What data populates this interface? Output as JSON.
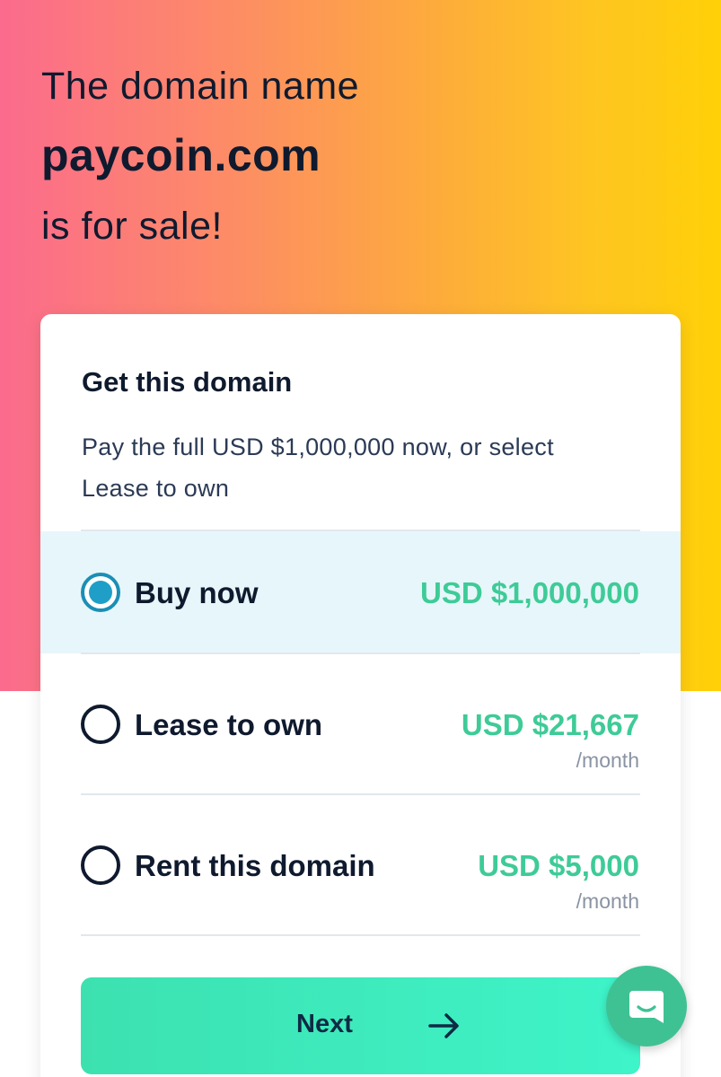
{
  "hero": {
    "line1": "The domain name",
    "domain": "paycoin.com",
    "line3": "is for sale!"
  },
  "card": {
    "title": "Get this domain",
    "description": "Pay the full USD $1,000,000 now, or select Lease to own"
  },
  "options": [
    {
      "label": "Buy now",
      "price": "USD $1,000,000",
      "period": "",
      "selected": true
    },
    {
      "label": "Lease to own",
      "price": "USD $21,667",
      "period": "/month",
      "selected": false
    },
    {
      "label": "Rent this domain",
      "price": "USD $5,000",
      "period": "/month",
      "selected": false
    }
  ],
  "next_button": {
    "label": "Next",
    "icon": "arrow-right-icon"
  },
  "chat_button": {
    "icon": "chat-icon"
  },
  "colors": {
    "accent_green": "#3ecb97",
    "selected_bg": "#e7f6fa",
    "radio_selected": "#1f9fc8",
    "button_green": "#3de1b0",
    "chat_green": "#3ec294",
    "gradient_start": "#fb6b8d",
    "gradient_end": "#ffd007",
    "text_dark": "#0f1a2e"
  }
}
